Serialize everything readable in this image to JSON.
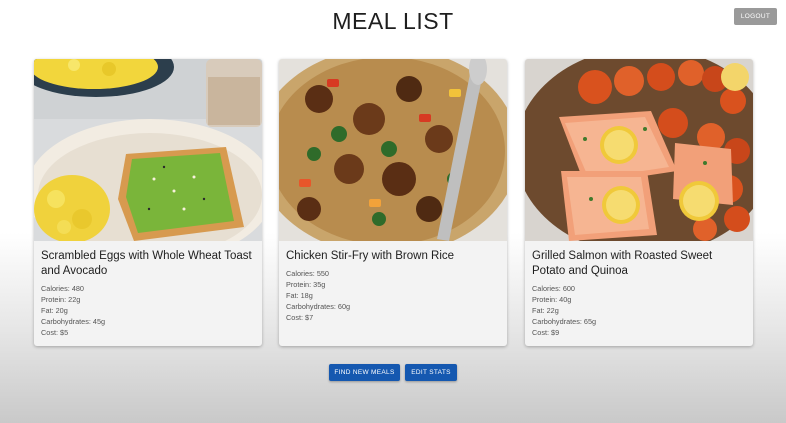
{
  "header": {
    "title": "MEAL LIST",
    "logout_label": "LOGOUT"
  },
  "meals": [
    {
      "name": "Scrambled Eggs with Whole Wheat Toast and Avocado",
      "calories": "Calories: 480",
      "protein": "Protein: 22g",
      "fat": "Fat: 20g",
      "carbohydrates": "Carbohydrates: 45g",
      "cost": "Cost: $5"
    },
    {
      "name": "Chicken Stir-Fry with Brown Rice",
      "calories": "Calories: 550",
      "protein": "Protein: 35g",
      "fat": "Fat: 18g",
      "carbohydrates": "Carbohydrates: 60g",
      "cost": "Cost: $7"
    },
    {
      "name": "Grilled Salmon with Roasted Sweet Potato and Quinoa",
      "calories": "Calories: 600",
      "protein": "Protein: 40g",
      "fat": "Fat: 22g",
      "carbohydrates": "Carbohydrates: 65g",
      "cost": "Cost: $9"
    }
  ],
  "actions": {
    "find_label": "FIND NEW MEALS",
    "edit_label": "EDIT STATS"
  },
  "colors": {
    "primary_button": "#1558b0",
    "logout_button": "#9a9a9a"
  }
}
